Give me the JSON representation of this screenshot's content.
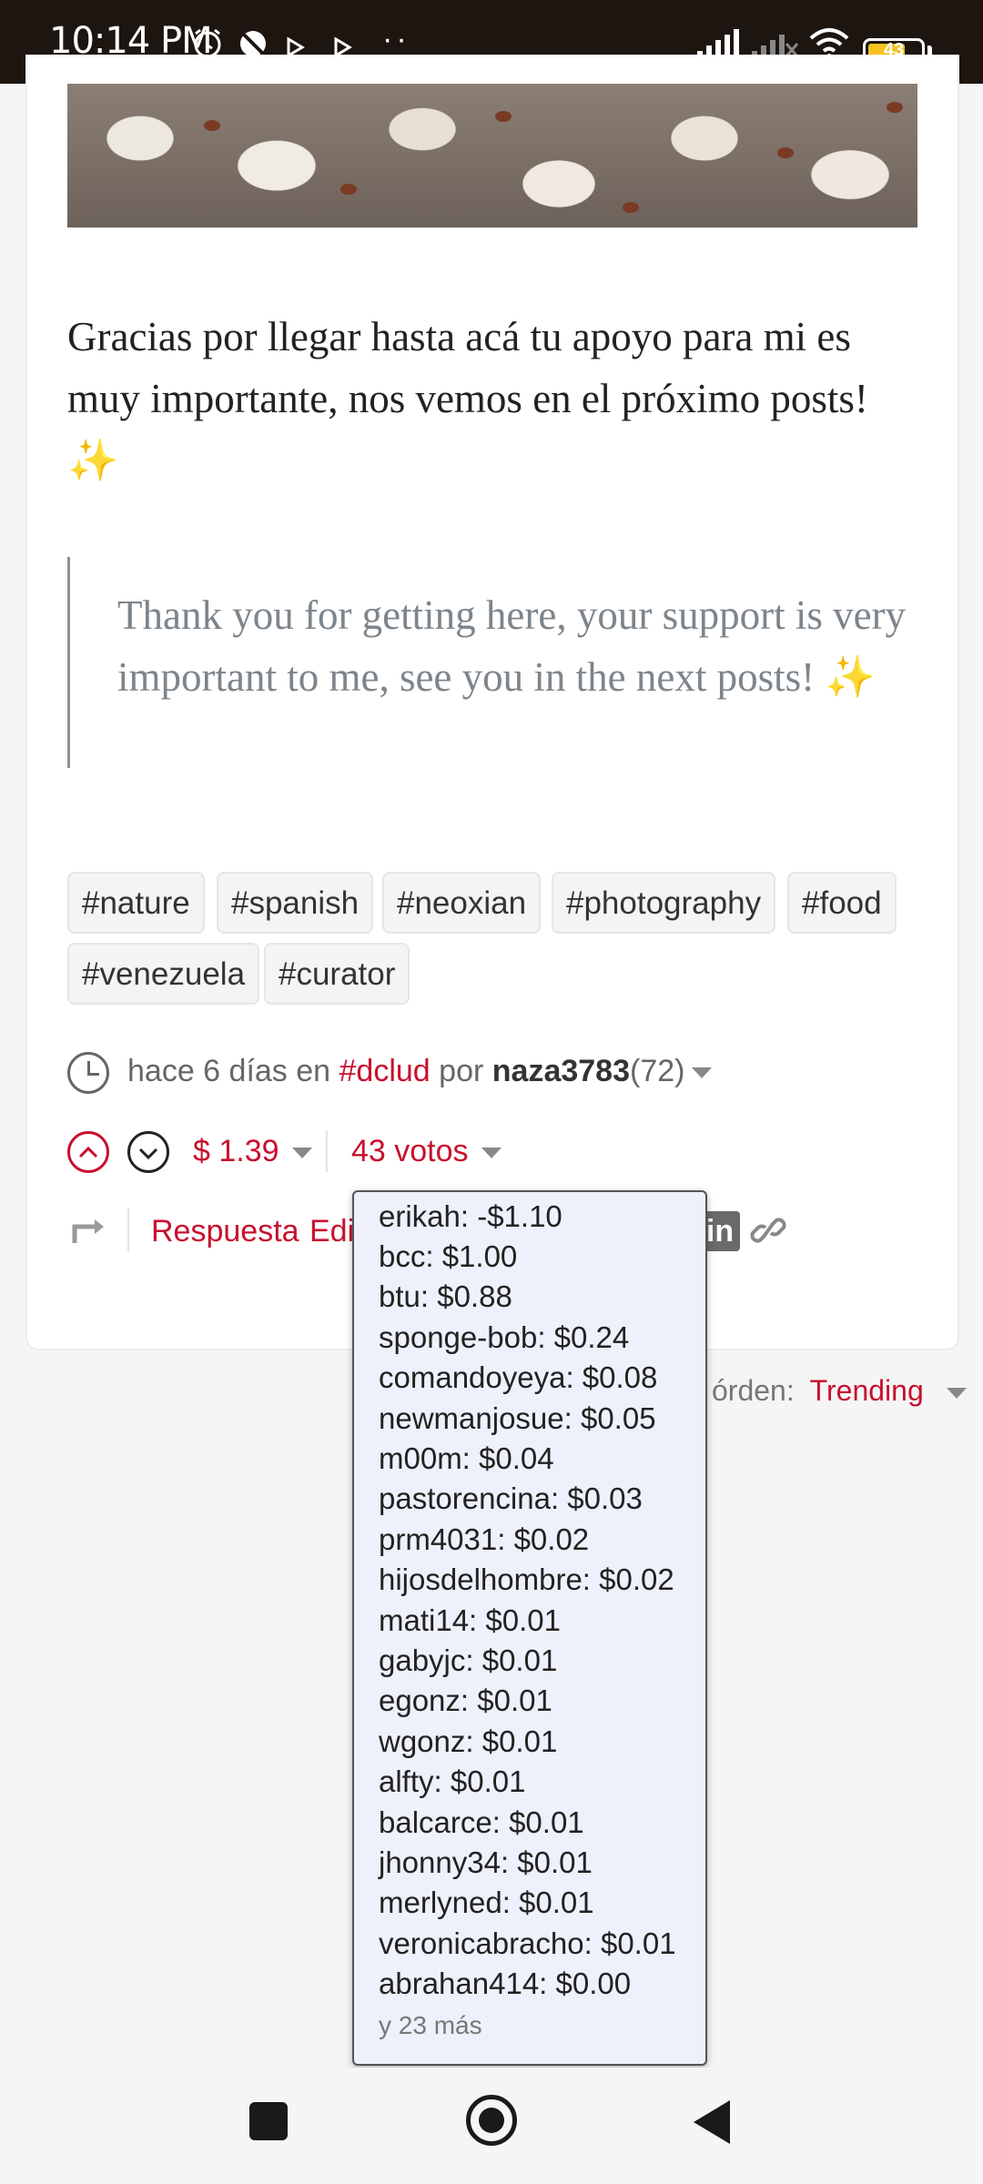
{
  "status_bar": {
    "time": "10:14 PM",
    "battery": "43",
    "icons": [
      "alarm-icon",
      "do-not-disturb-icon",
      "play-icon",
      "play-icon",
      "more-dots-icon",
      "signal-icon",
      "signal-off-icon",
      "wifi-icon",
      "battery-icon"
    ]
  },
  "post": {
    "paragraph": "Gracias por llegar hasta acá tu apoyo para mi es muy importante, nos vemos en el próximo posts! ✨",
    "quote": "Thank you for getting here, your support is very important to me, see you in the next posts! ✨",
    "tags": [
      "#nature",
      "#spanish",
      "#neoxian",
      "#photography",
      "#food",
      "#venezuela",
      "#curator"
    ]
  },
  "meta": {
    "prefix": "hace 6 días en",
    "community": "#dclud",
    "by": "por",
    "author": "naza3783",
    "reputation": "(72)"
  },
  "votes": {
    "payout": "$ 1.39",
    "count_label": "43 votos"
  },
  "actions": {
    "reply": "Respuesta",
    "edit": "Edi"
  },
  "sort": {
    "label": "órden:",
    "value": "Trending"
  },
  "voters": {
    "list": [
      "erikah: -$1.10",
      "bcc: $1.00",
      "btu: $0.88",
      "sponge-bob: $0.24",
      "comandoyeya: $0.08",
      "newmanjosue: $0.05",
      "m00m: $0.04",
      "pastorencina: $0.03",
      "prm4031: $0.02",
      "hijosdelhombre: $0.02",
      "mati14: $0.01",
      "gabyjc: $0.01",
      "egonz: $0.01",
      "wgonz: $0.01",
      "alfty: $0.01",
      "balcarce: $0.01",
      "jhonny34: $0.01",
      "merlyned: $0.01",
      "veronicabracho: $0.01",
      "abrahan414: $0.00"
    ],
    "more": "y 23 más"
  }
}
